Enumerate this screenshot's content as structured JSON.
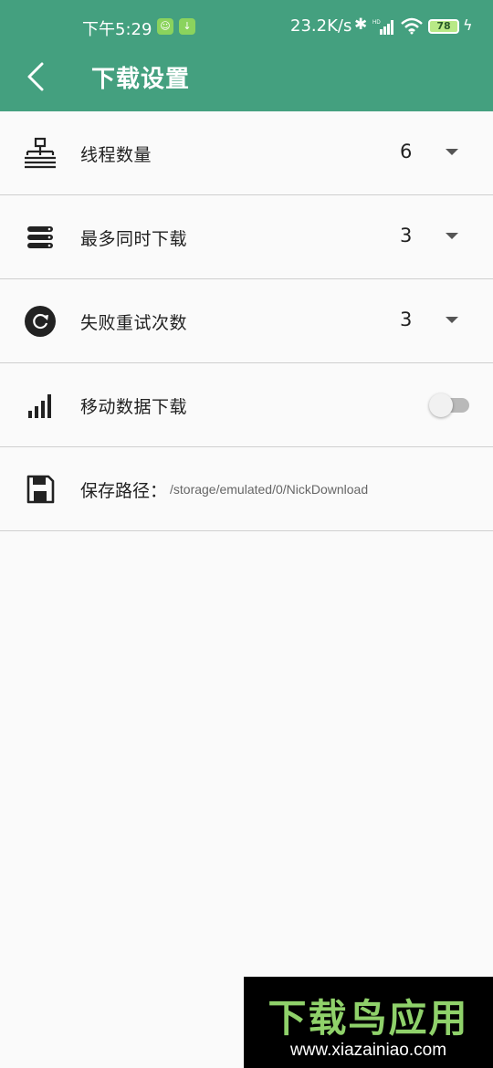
{
  "status_bar": {
    "time": "下午5:29",
    "net_speed": "23.2K/s",
    "battery": "78",
    "hd_label": "HD"
  },
  "toolbar": {
    "title": "下载设置"
  },
  "settings": {
    "thread_count": {
      "label": "线程数量",
      "value": "6",
      "icon": "network-tree-icon"
    },
    "max_concurrent": {
      "label": "最多同时下载",
      "value": "3",
      "icon": "stack-icon"
    },
    "retry_count": {
      "label": "失败重试次数",
      "value": "3",
      "icon": "refresh-icon"
    },
    "mobile_data": {
      "label": "移动数据下载",
      "enabled": false,
      "icon": "signal-bars-icon"
    },
    "save_path": {
      "label": "保存路径：",
      "value": "/storage/emulated/0/NickDownload",
      "icon": "floppy-disk-icon"
    }
  },
  "watermark": {
    "title": "下载鸟应用",
    "url": "www.xiazainiao.com"
  },
  "colors": {
    "header": "#44a07f",
    "background": "#fafafa",
    "divider": "#cfcfcf"
  }
}
